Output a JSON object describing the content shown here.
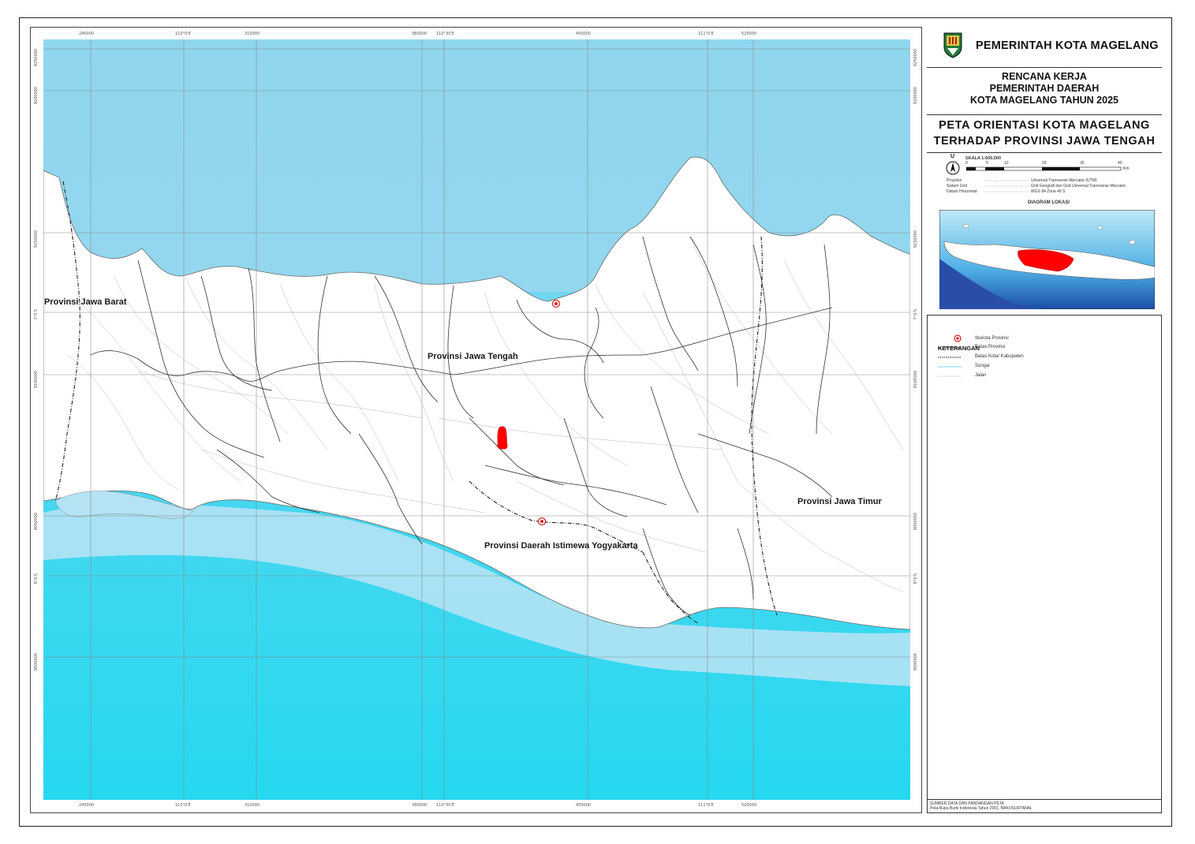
{
  "header": {
    "agency": "PEMERINTAH KOTA MAGELANG",
    "plan_lines": [
      "RENCANA KERJA",
      "PEMERINTAH DAERAH",
      "KOTA MAGELANG TAHUN 2025"
    ],
    "map_title_lines": [
      "PETA ORIENTASI KOTA MAGELANG",
      "TERHADAP PROVINSI JAWA TENGAH"
    ]
  },
  "scale": {
    "north_letter": "U",
    "label": "SKALA  1:600,000",
    "ticks": [
      "0",
      "5",
      "10",
      "20",
      "30",
      "40"
    ],
    "unit": "Km"
  },
  "projection": {
    "rows": [
      {
        "key": "Proyeksi",
        "value": "Universal Transverse Mercator (UTM)"
      },
      {
        "key": "Sistem Grid",
        "value": "Grid Geografi dan Grid Universal Transverse Mercator"
      },
      {
        "key": "Datum Horizontal",
        "value": "WGS 84 Zona 49 S"
      }
    ]
  },
  "inset": {
    "title": "DIAGRAM LOKASI"
  },
  "legend": {
    "title": "KETERANGAN",
    "items": [
      {
        "label": "Ibukota Provinsi",
        "symbol": "capital-dot"
      },
      {
        "label": "Batas Provinsi",
        "symbol": "dash-dot-line"
      },
      {
        "label": "Batas Kota/ Kabupaten",
        "symbol": "dotted-line"
      },
      {
        "label": "Sungai",
        "symbol": "blue-line"
      },
      {
        "label": "Jalan",
        "symbol": "grey-line"
      }
    ]
  },
  "source": {
    "lines": [
      "SUMBER DATA DAN PANDANGAN PETA",
      "Peta Rupa Bumi Indonesia Tahun 2001, BAKOSURTANAL"
    ]
  },
  "map": {
    "labels": {
      "jabar": "Provinsi Jawa Barat",
      "jateng": "Provinsi Jawa Tengah",
      "jatim": "Provinsi Jawa Timur",
      "diy": "Provinsi Daerah Istimewa Yogyakarta"
    },
    "top_ticks": [
      "240000",
      "110°0'E",
      "310000",
      "380000",
      "110°30'E",
      "450000",
      "111°0'E",
      "520000"
    ],
    "left_ticks": [
      "9250000",
      "9200000",
      "9150000",
      "7°0'S",
      "9100000",
      "9050000",
      "8°0'S",
      "9000000"
    ],
    "colors": {
      "sea_deep": "#2dd6f0",
      "sea_shallow": "#8fd6ee",
      "land": "#ffffff",
      "highlight": "#ff0000",
      "capital": "#d91f1f"
    }
  }
}
